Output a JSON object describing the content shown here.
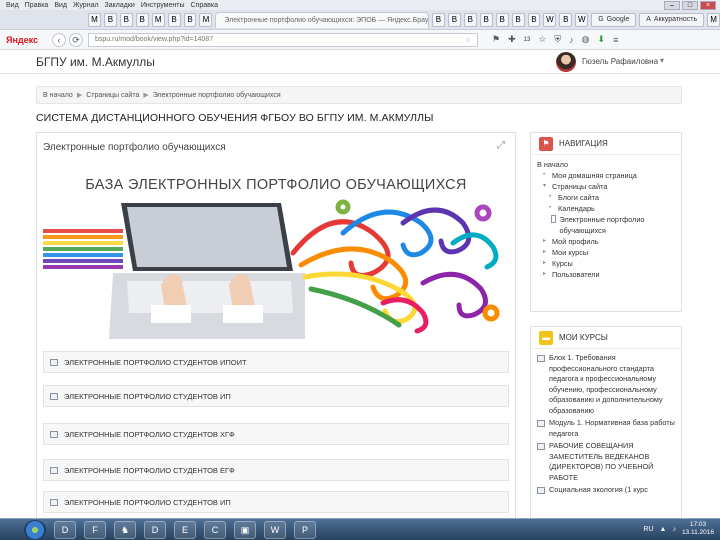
{
  "browser": {
    "menu": [
      "Вид",
      "Правка",
      "Вид",
      "Журнал",
      "Закладки",
      "Инструменты",
      "Справка"
    ],
    "active_tab_title": "Электронные портфолио обучающихся: ЭПОБ — Яндекс.Браузер",
    "labeled_tabs": [
      {
        "icon": "G",
        "label": "Google"
      },
      {
        "icon": "A",
        "label": "Аккуратность"
      }
    ],
    "favicon_tabs": [
      "M",
      "B",
      "B",
      "B",
      "M",
      "B",
      "B",
      "M",
      "B",
      "B",
      "B",
      "B",
      "B",
      "B",
      "B",
      "W",
      "B",
      "W",
      "M"
    ],
    "window_buttons": [
      "–",
      "□",
      "×"
    ],
    "yandex_logo": "Яндекс",
    "url": "bspu.ru/mod/book/view.php?id=14087",
    "download_count": "13"
  },
  "site": {
    "brand": "БГПУ им. М.Акмуллы",
    "user": {
      "name": "Гюзель Рафаиловна",
      "caret": "▾"
    },
    "breadcrumb": [
      "В начало",
      "Страницы сайта",
      "Электронные портфолио обучающихся"
    ],
    "page_title": "СИСТЕМА ДИСТАНЦИОННОГО ОБУЧЕНИЯ ФГБОУ ВО БГПУ ИМ. М.АКМУЛЛЫ"
  },
  "main": {
    "card_title": "Электронные портфолио обучающихся",
    "banner_title": "БАЗА ЭЛЕКТРОННЫХ ПОРТФОЛИО ОБУЧАЮЩИХСЯ",
    "links": [
      "ЭЛЕКТРОННЫЕ ПОРТФОЛИО СТУДЕНТОВ ИПОИТ",
      "ЭЛЕКТРОННЫЕ ПОРТФОЛИО СТУДЕНТОВ ИП",
      "ЭЛЕКТРОННЫЕ ПОРТФОЛИО СТУДЕНТОВ ХГФ",
      "ЭЛЕКТРОННЫЕ ПОРТФОЛИО СТУДЕНТОВ ЕГФ",
      "ЭЛЕКТРОННЫЕ ПОРТФОЛИО СТУДЕНТОВ ИП"
    ]
  },
  "navigation": {
    "title": "НАВИГАЦИЯ",
    "items": [
      {
        "label": "В начало",
        "level": 0,
        "marker": ""
      },
      {
        "label": "Моя домашняя страница",
        "level": 1,
        "marker": "•"
      },
      {
        "label": "Страницы сайта",
        "level": 1,
        "marker": "▾"
      },
      {
        "label": "Блоги сайта",
        "level": 2,
        "marker": "•"
      },
      {
        "label": "Календарь",
        "level": 2,
        "marker": "•"
      },
      {
        "label": "Электронные портфолио обучающихся",
        "level": 3,
        "marker": "page"
      },
      {
        "label": "Мой профиль",
        "level": 1,
        "marker": "▸"
      },
      {
        "label": "Мои курсы",
        "level": 1,
        "marker": "▸"
      },
      {
        "label": "Курсы",
        "level": 1,
        "marker": "▸"
      },
      {
        "label": "Пользователи",
        "level": 1,
        "marker": "▸"
      }
    ]
  },
  "my_courses": {
    "title": "МОИ КУРСЫ",
    "items": [
      "Блок 1. Требования профессионального стандарта педагога к профессиональному обучению, профессиональному образованию и дополнительному образованию",
      "Модуль 1. Нормативная база работы педагога",
      "РАБОЧИЕ СОВЕЩАНИЯ ЗАМЕСТИТЕЛЬ ВЕДЕКАНОВ (ДИРЕКТОРОВ) ПО УЧЕБНОЙ РАБОТЕ",
      "Социальная экология (1 курс"
    ]
  },
  "taskbar": {
    "apps": [
      "D",
      "F",
      "♞",
      "D",
      "E",
      "C",
      "▣",
      "W",
      "P"
    ],
    "tray_lang": "RU",
    "time": "17:03",
    "date": "13.11.2016"
  },
  "colors": {
    "nav_icon": "#d9534f",
    "courses_icon": "#f0c419",
    "yandex_red": "#e0141e"
  }
}
